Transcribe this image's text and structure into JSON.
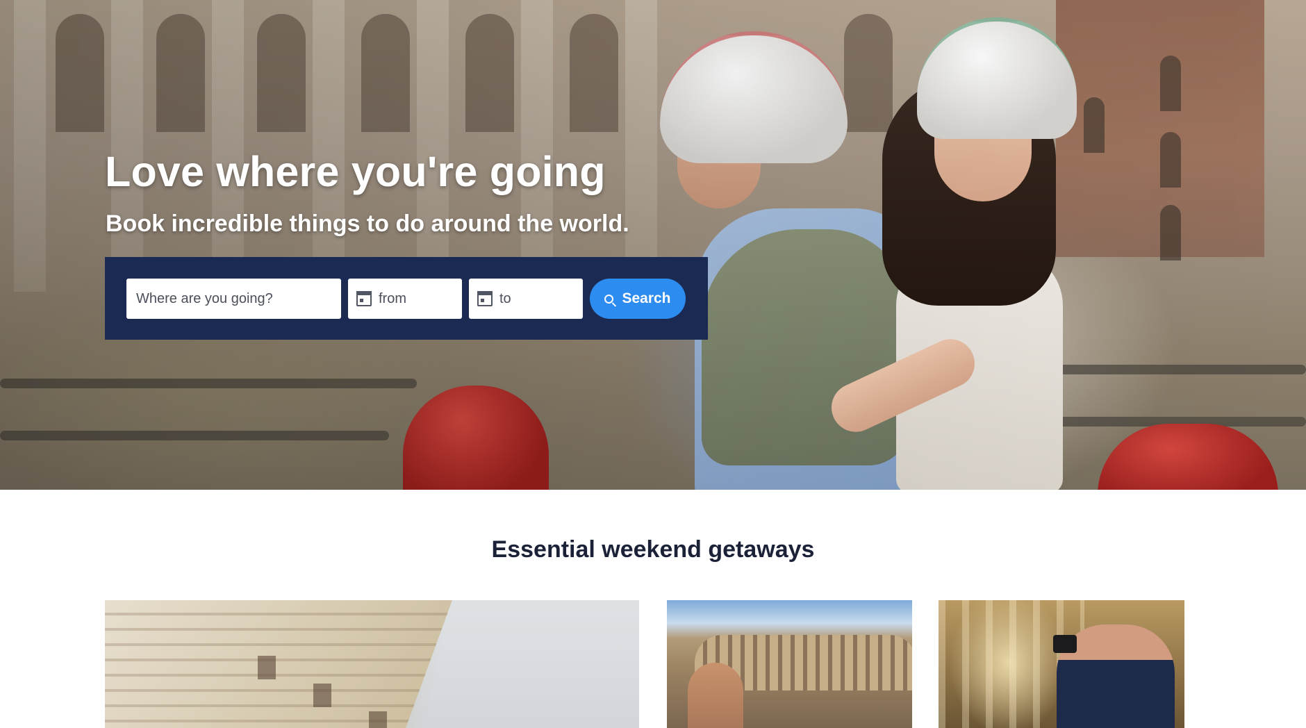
{
  "hero": {
    "title": "Love where you're going",
    "subtitle": "Book incredible things to do around the world."
  },
  "search": {
    "destination_placeholder": "Where are you going?",
    "from_placeholder": "from",
    "to_placeholder": "to",
    "button_label": "Search",
    "panel_color": "#1b2a52",
    "button_color": "#2d8cf0"
  },
  "icons": {
    "search": "search-icon",
    "calendar": "calendar-icon"
  },
  "section": {
    "title": "Essential weekend getaways"
  }
}
